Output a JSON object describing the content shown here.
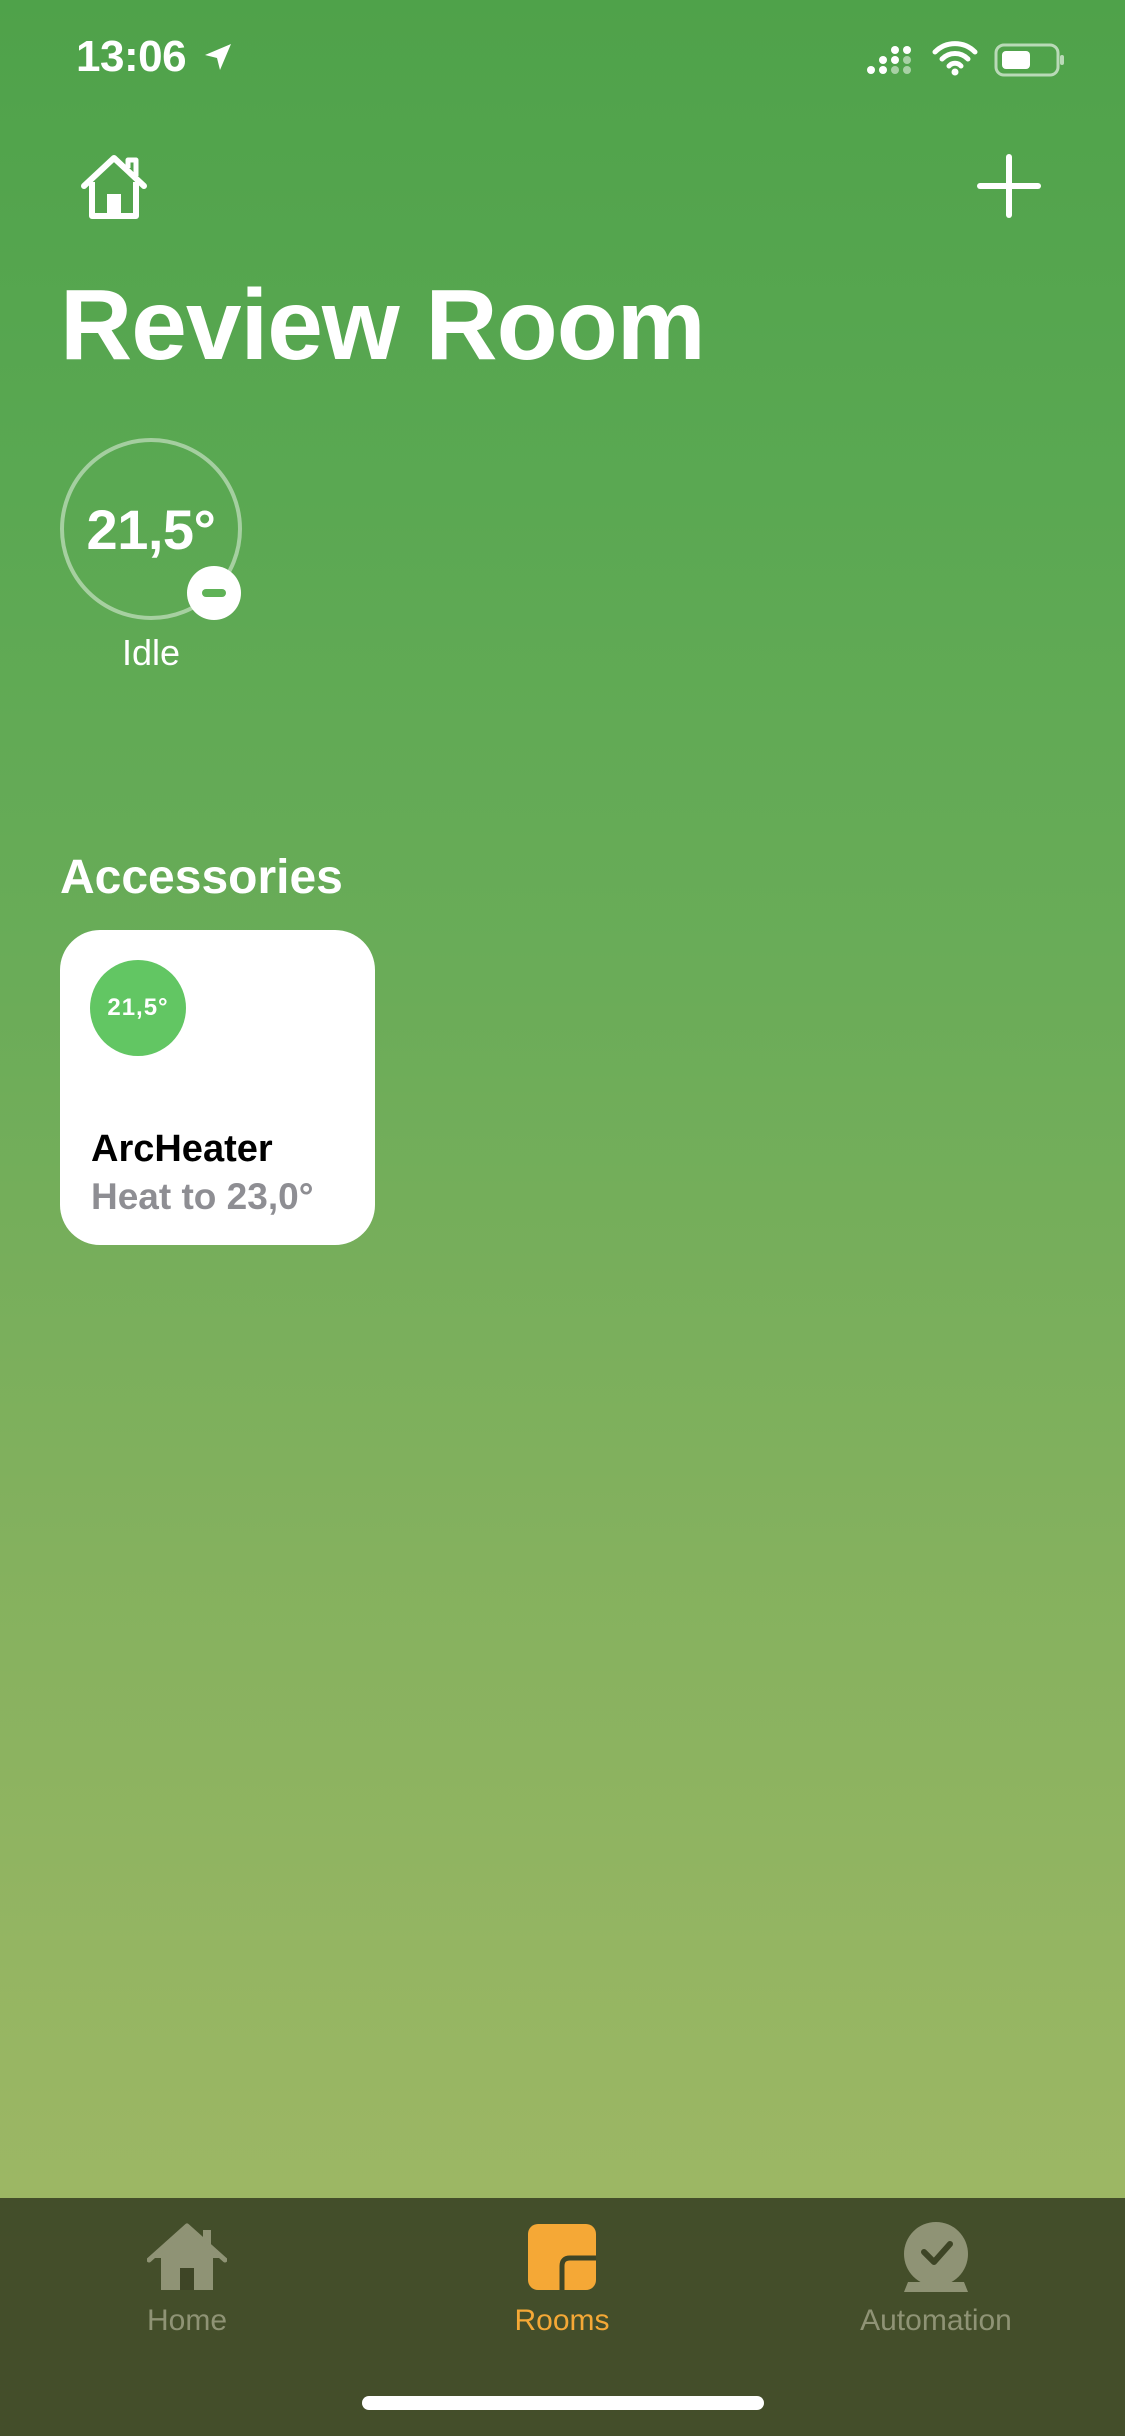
{
  "status_bar": {
    "time": "13:06"
  },
  "header": {
    "title": "Review Room"
  },
  "climate": {
    "temperature": "21,5°",
    "state": "Idle"
  },
  "accessories": {
    "section_title": "Accessories",
    "items": [
      {
        "badge": "21,5°",
        "name": "ArcHeater",
        "status": "Heat to 23,0°"
      }
    ]
  },
  "tab_bar": {
    "tabs": [
      {
        "label": "Home",
        "icon": "house-icon"
      },
      {
        "label": "Rooms",
        "icon": "rooms-icon"
      },
      {
        "label": "Automation",
        "icon": "automation-clock-icon"
      }
    ],
    "active": "Rooms"
  },
  "colors": {
    "background_top": "#4fa24a",
    "background_bottom": "#a4b966",
    "accent_active_tab": "#f5a836",
    "badge_green": "#62c663"
  }
}
